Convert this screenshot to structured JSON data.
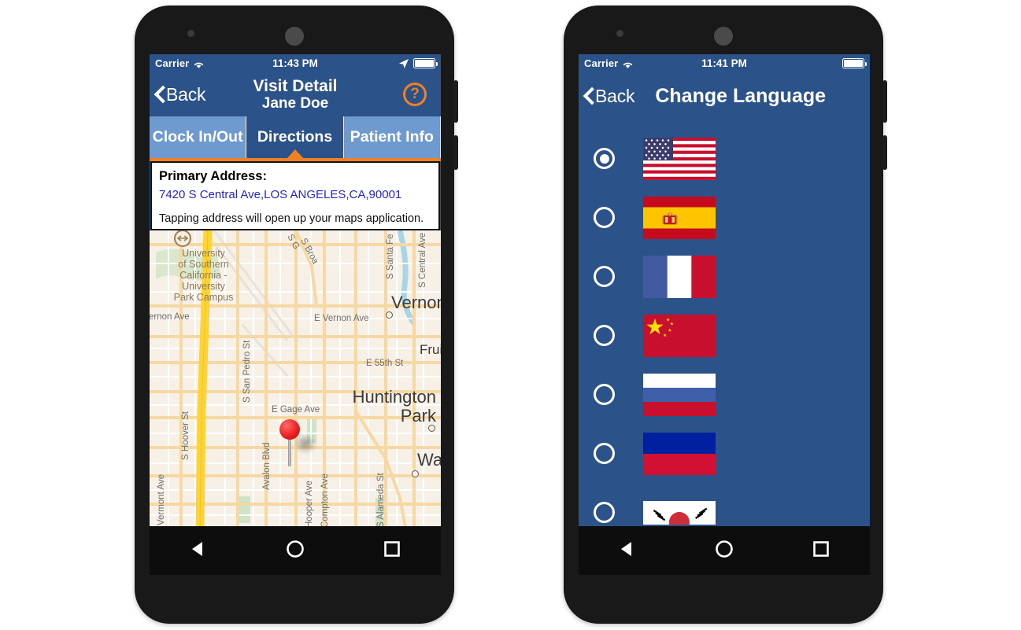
{
  "left_phone": {
    "status_bar": {
      "carrier": "Carrier",
      "wifi_icon": "wifi-icon",
      "time": "11:43 PM",
      "location_icon": "location-arrow-icon",
      "battery_icon": "battery-full-icon"
    },
    "nav": {
      "back_label": "Back",
      "back_icon": "chevron-left-icon",
      "title": "Visit Detail",
      "subtitle": "Jane Doe",
      "help_icon": "question-mark-circle-icon",
      "help_glyph": "?",
      "help_color": "#f08022"
    },
    "tabs": [
      {
        "label": "Clock In/Out",
        "active": false
      },
      {
        "label": "Directions",
        "active": true
      },
      {
        "label": "Patient Info",
        "active": false
      }
    ],
    "address_card": {
      "title": "Primary Address:",
      "address": "7420 S Central Ave,LOS ANGELES,CA,90001",
      "hint": "Tapping address will open up your maps application.",
      "link_color": "#2323d8"
    },
    "map": {
      "pin_icon": "map-pin-icon",
      "poi_icon": "university-marker-icon",
      "labels": [
        "University",
        "of Southern",
        "California -",
        "University",
        "Park Campus",
        "S G...",
        "S Broa...",
        "S Central Ave",
        "S Santa Fe",
        "Vernon",
        "E Vernon Ave",
        "Vernon Ave",
        "Fruitl",
        "E 55th St",
        "Huntington",
        "Park",
        "Wa",
        "E Gage Ave",
        "S San Pedro St",
        "S Hoover St",
        "Vermont Ave",
        "Avalon Blvd",
        "Hooper Ave",
        "Compton Ave",
        "S Alameda St"
      ]
    },
    "android_nav": {
      "back_icon": "triangle-back-icon",
      "home_icon": "circle-home-icon",
      "recents_icon": "square-recents-icon"
    }
  },
  "right_phone": {
    "status_bar": {
      "carrier": "Carrier",
      "wifi_icon": "wifi-icon",
      "time": "11:41 PM",
      "battery_icon": "battery-full-icon"
    },
    "nav": {
      "back_label": "Back",
      "back_icon": "chevron-left-icon",
      "title": "Change Language"
    },
    "languages": [
      {
        "flag": "united-states-flag",
        "selected": true
      },
      {
        "flag": "spain-flag",
        "selected": false
      },
      {
        "flag": "france-flag",
        "selected": false
      },
      {
        "flag": "china-flag",
        "selected": false
      },
      {
        "flag": "russia-flag",
        "selected": false
      },
      {
        "flag": "haiti-flag",
        "selected": false
      },
      {
        "flag": "south-korea-flag",
        "selected": false
      }
    ],
    "bottom_bar_color": "#f08022",
    "android_nav": {
      "back_icon": "triangle-back-icon",
      "home_icon": "circle-home-icon",
      "recents_icon": "square-recents-icon"
    }
  },
  "theme": {
    "header_blue": "#2b5289",
    "tab_inactive_blue": "#6f9ad0",
    "accent_orange": "#f08022",
    "phone_body": "#191919"
  }
}
